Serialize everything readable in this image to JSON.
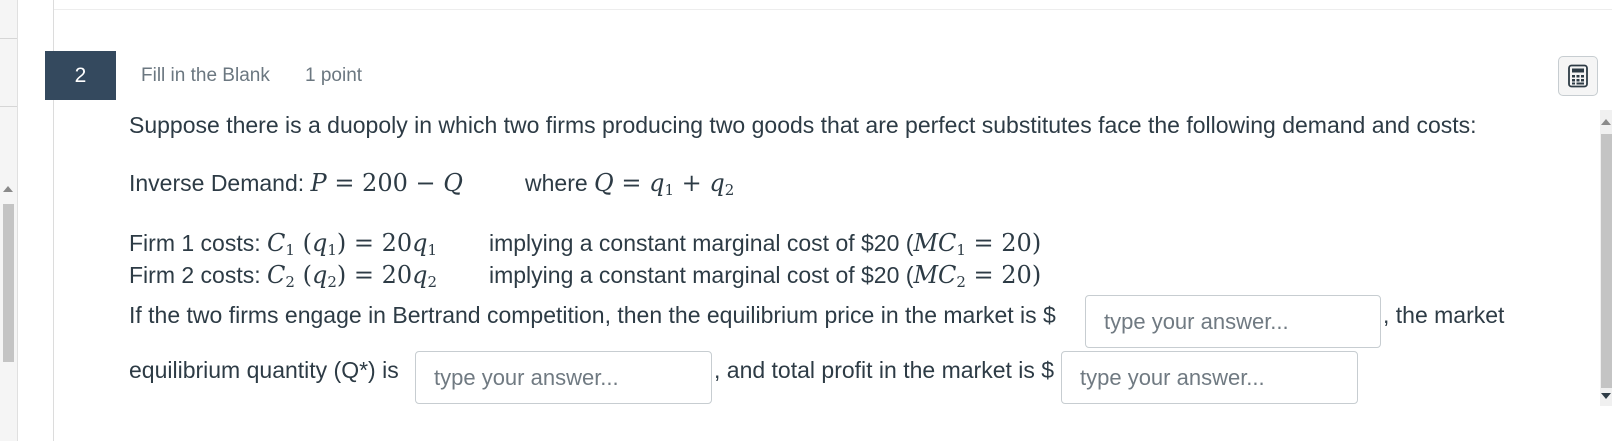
{
  "question": {
    "number": "2",
    "type": "Fill in the Blank",
    "points": "1 point"
  },
  "icons": {
    "calculator": "calculator-icon",
    "scroll_up": "scroll-up-arrow-icon",
    "scroll_down": "scroll-down-arrow-icon"
  },
  "body": {
    "intro": "Suppose there is a duopoly in which two firms producing two goods that are perfect substitutes face the following demand and costs:",
    "demand_label": "Inverse Demand:",
    "demand_eq_p": "P",
    "demand_eq_rest": " = 200 − ",
    "demand_eq_q": "Q",
    "where_label": "where",
    "where_q": "Q",
    "where_eq": " = ",
    "where_q1": "q",
    "where_q1_sub": "1",
    "where_plus": " + ",
    "where_q2": "q",
    "where_q2_sub": "2",
    "firm1_label": "Firm 1 costs:",
    "firm1_c": "C",
    "firm1_c_sub": "1",
    "firm1_paren_open": " (",
    "firm1_q": "q",
    "firm1_q_sub": "1",
    "firm1_paren_close": ") = 20",
    "firm1_q2": "q",
    "firm1_q2_sub": "1",
    "firm1_implying": "implying a constant marginal cost of $20 (",
    "firm1_mc": "MC",
    "firm1_mc_sub": "1",
    "firm1_mc_eq": " = 20)",
    "firm2_label": "Firm 2 costs:",
    "firm2_c": "C",
    "firm2_c_sub": "2",
    "firm2_paren_open": " (",
    "firm2_q": "q",
    "firm2_q_sub": "2",
    "firm2_paren_close": ") = 20",
    "firm2_q2": "q",
    "firm2_q2_sub": "2",
    "firm2_implying": "implying a constant marginal cost of $20 (",
    "firm2_mc": "MC",
    "firm2_mc_sub": "2",
    "firm2_mc_eq": " = 20)",
    "prompt_part1": "If the two firms engage in Bertrand competition, then the equilibrium price in the market is $",
    "prompt_part2": ", the market",
    "prompt_part3": "equilibrium quantity (Q*) is",
    "prompt_part4": ", and total profit in the market is $"
  },
  "blanks": {
    "price_placeholder": "type your answer...",
    "price_value": "",
    "quantity_placeholder": "type your answer...",
    "quantity_value": "",
    "profit_placeholder": "type your answer...",
    "profit_value": ""
  }
}
